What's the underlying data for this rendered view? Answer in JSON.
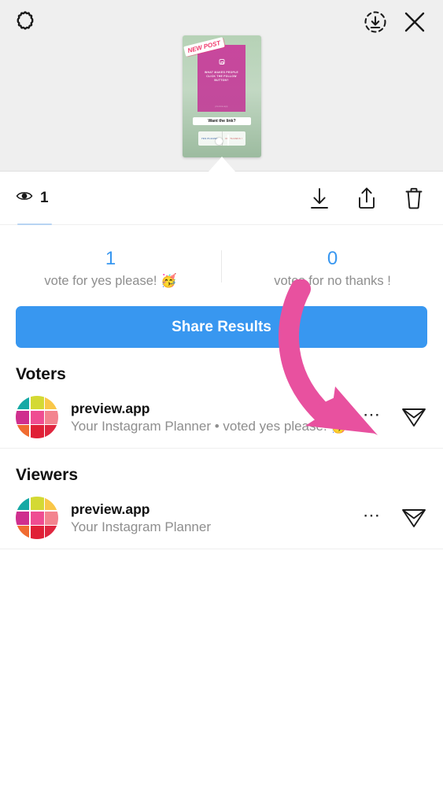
{
  "header": {
    "settings_icon": "gear-icon",
    "download_icon": "download-circle-icon",
    "close_icon": "close-icon",
    "story_thumbnail": {
      "sticker_label": "NEW\nPOST",
      "card_text": "WHAT MAKES PEOPLE CLICK THE FOLLOW BUTTON?",
      "card_handle": "preview.app",
      "question": "Want the link?",
      "poll_yes": "YES PLEASE!",
      "poll_no": "NO THANKS !"
    }
  },
  "actionbar": {
    "views_icon": "eye-icon",
    "views_count": "1",
    "save_icon": "download-icon",
    "share_icon": "share-up-icon",
    "delete_icon": "trash-icon"
  },
  "results": {
    "yes": {
      "count": "1",
      "label": "vote for yes please! 🥳"
    },
    "no": {
      "count": "0",
      "label": "votes for no thanks !"
    },
    "accent_color": "#3897f0"
  },
  "share_button": {
    "label": "Share Results"
  },
  "voters": {
    "title": "Voters",
    "rows": [
      {
        "username": "preview.app",
        "subtitle": "Your Instagram Planner • voted yes please! 🥳",
        "menu_icon": "more-options-icon",
        "send_icon": "send-icon"
      }
    ]
  },
  "viewers": {
    "title": "Viewers",
    "rows": [
      {
        "username": "preview.app",
        "subtitle": "Your Instagram Planner",
        "menu_icon": "more-options-icon",
        "send_icon": "send-icon"
      }
    ]
  },
  "avatar": {
    "tiles": [
      "#16a9a5",
      "#d4d933",
      "#f9c748",
      "#cf2f8e",
      "#ef4d92",
      "#f3848f",
      "#f06c31",
      "#e01f36",
      "#e0263f"
    ]
  },
  "annotation": {
    "arrow_color": "#e8519f",
    "icon": "curved-arrow-annotation"
  }
}
